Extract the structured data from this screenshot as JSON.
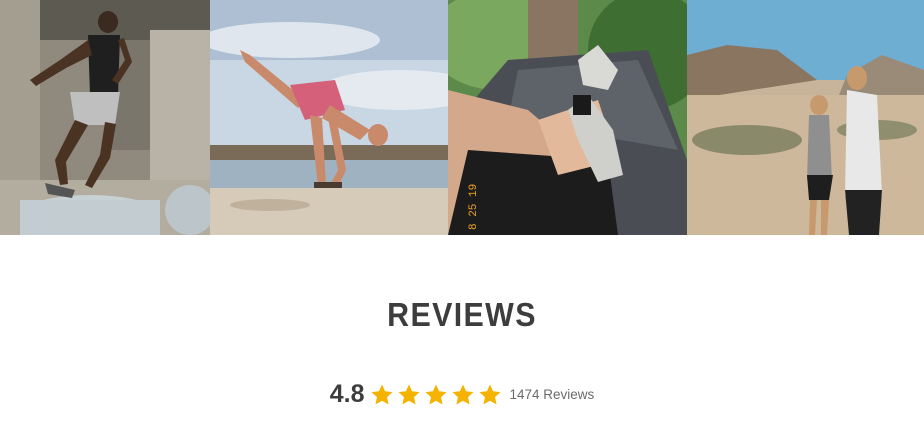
{
  "gallery": {
    "photos": [
      {
        "subject": "athlete jumping on tires under bridge"
      },
      {
        "subject": "yoga arm balance on beach"
      },
      {
        "subject": "feet in hammock"
      },
      {
        "subject": "couple drinking in desert"
      }
    ],
    "film_stamp": "8 25 19"
  },
  "reviews": {
    "heading": "REVIEWS",
    "rating": "4.8",
    "stars": 5,
    "star_color": "#f5b301",
    "count_label": "1474 Reviews"
  },
  "colors": {
    "heading": "#3d3d3d",
    "count_text": "#6b6b6b"
  }
}
